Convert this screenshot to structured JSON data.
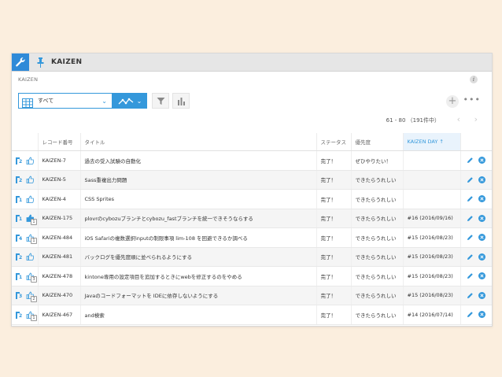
{
  "app": {
    "title": "KAIZEN",
    "subtitle": "KAIZEN",
    "info": "i"
  },
  "toolbar": {
    "view_select": "すべて",
    "add": "+",
    "more": "•••"
  },
  "pager": {
    "range": "61 - 80 （191件中）",
    "prev": "‹",
    "next": "›"
  },
  "table": {
    "headers": [
      "レコード番号",
      "タイトル",
      "ステータス",
      "優先度",
      "KAIZEN DAY ↑"
    ],
    "rows": [
      {
        "level": "2",
        "liked": false,
        "likes": "",
        "id": "KAIZEN-7",
        "title": "過去の受入試験の自動化",
        "status": "完了！",
        "priority": "ぜひやりたい！",
        "day": ""
      },
      {
        "level": "2",
        "liked": false,
        "likes": "",
        "id": "KAIZEN-5",
        "title": "Sass重複出力問題",
        "status": "完了！",
        "priority": "できたらうれしい",
        "day": ""
      },
      {
        "level": "1",
        "liked": false,
        "likes": "",
        "id": "KAIZEN-4",
        "title": "CSS Sprites",
        "status": "完了！",
        "priority": "できたらうれしい",
        "day": ""
      },
      {
        "level": "1",
        "liked": true,
        "likes": "1",
        "id": "KAIZEN-175",
        "title": "plovrのcybozuブランチとcybozu_fastブランチを統一できそうならする",
        "status": "完了！",
        "priority": "できたらうれしい",
        "day": "#16 (2016/09/16)"
      },
      {
        "level": "4",
        "liked": false,
        "likes": "1",
        "id": "KAIZEN-484",
        "title": "iOS Safariの複数選択inputの制限事項 lim-108 を回避できるか調べる",
        "status": "完了！",
        "priority": "できたらうれしい",
        "day": "#15 (2016/08/23)"
      },
      {
        "level": "2",
        "liked": false,
        "likes": "",
        "id": "KAIZEN-481",
        "title": "バックログを優先度順に並べられるようにする",
        "status": "完了！",
        "priority": "できたらうれしい",
        "day": "#15 (2016/08/23)"
      },
      {
        "level": "1",
        "liked": false,
        "likes": "3",
        "id": "KAIZEN-478",
        "title": "kintone専用の設定項目を追加するときにwebを修正するのをやめる",
        "status": "完了！",
        "priority": "できたらうれしい",
        "day": "#15 (2016/08/23)"
      },
      {
        "level": "3",
        "liked": false,
        "likes": "2",
        "id": "KAIZEN-470",
        "title": "Javaのコードフォーマットを IDEに依存しないようにする",
        "status": "完了！",
        "priority": "できたらうれしい",
        "day": "#15 (2016/08/23)"
      },
      {
        "level": "2",
        "liked": false,
        "likes": "1",
        "id": "KAIZEN-467",
        "title": "and検索",
        "status": "完了！",
        "priority": "できたらうれしい",
        "day": "#14 (2016/07/14)"
      }
    ]
  },
  "colors": {
    "accent": "#3498db",
    "background": "#fbeede"
  },
  "icons": {
    "app": "wrench-icon",
    "pin": "pin-icon",
    "view": "table-view-icon",
    "graph": "line-graph-icon",
    "filter": "filter-icon",
    "chart": "bar-chart-icon",
    "edit": "pencil-icon",
    "delete": "delete-icon",
    "like": "thumbs-up-icon",
    "level": "flag-level-icon"
  }
}
